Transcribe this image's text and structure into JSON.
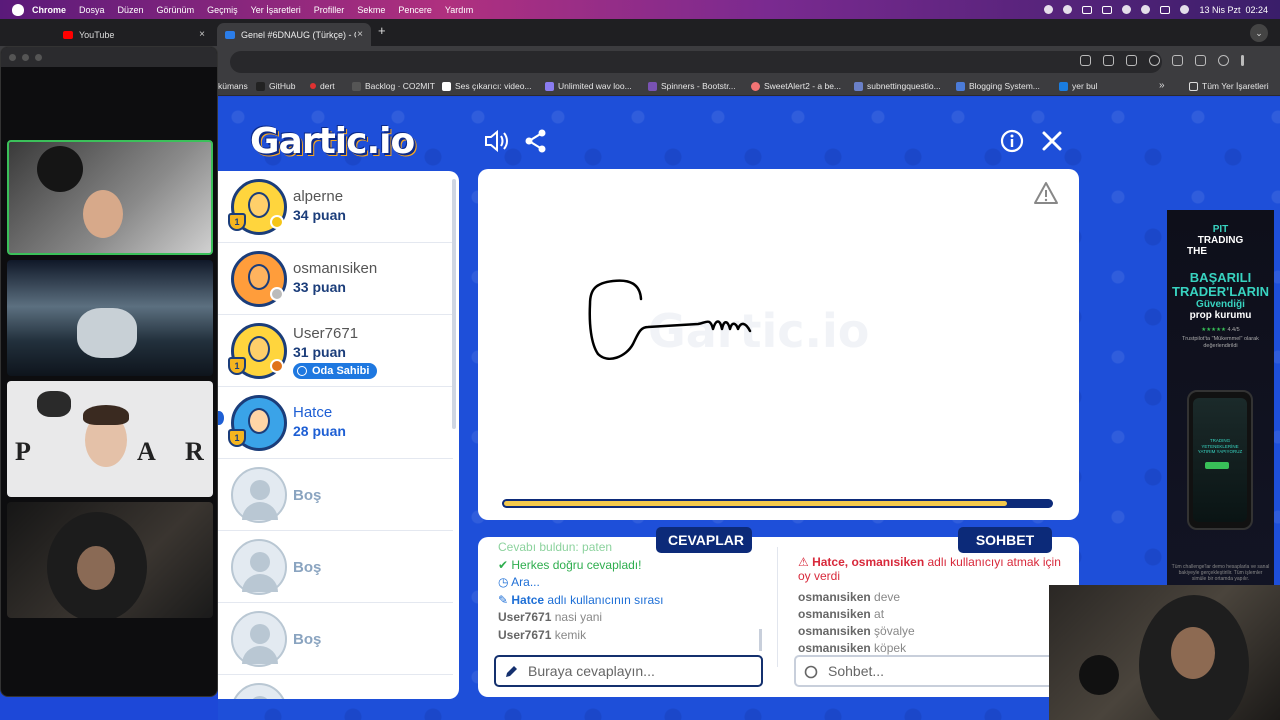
{
  "menubar": {
    "app": "Chrome",
    "items": [
      "Dosya",
      "Düzen",
      "Görünüm",
      "Geçmiş",
      "Yer İşaretleri",
      "Profiller",
      "Sekme",
      "Pencere",
      "Yardım"
    ],
    "clock": "13 Nis Pzt  02:24"
  },
  "tabs": [
    {
      "title": "YouTube",
      "favicon_color": "#ff0000"
    },
    {
      "title": "Genel #6DNAUG (Türkçe) - G",
      "favicon_color": "#2b7de9"
    }
  ],
  "bookmarks": [
    {
      "label": "kümans"
    },
    {
      "label": "GitHub"
    },
    {
      "label": "dert"
    },
    {
      "label": "Backlog · CO2MIT"
    },
    {
      "label": "Ses çıkarıcı: video..."
    },
    {
      "label": "Unlimited wav loo..."
    },
    {
      "label": "Spinners - Bootstr..."
    },
    {
      "label": "SweetAlert2 - a be..."
    },
    {
      "label": "subnettingquestio..."
    },
    {
      "label": "Blogging System..."
    },
    {
      "label": "yer bul"
    },
    {
      "label": "Tüm Yer İşaretleri"
    }
  ],
  "game": {
    "logo": "Gartic.io",
    "watermark": "Gartic.io",
    "timer_fraction": 0.92,
    "players": [
      {
        "name": "alperne",
        "score": "34 puan",
        "avatar": "yellow",
        "status_color": "#f5c518",
        "trophy": true
      },
      {
        "name": "osmanısiken",
        "score": "33 puan",
        "avatar": "orange",
        "status_color": "#bbbbbb",
        "trophy": false
      },
      {
        "name": "User7671",
        "score": "31 puan",
        "avatar": "yellow",
        "status_color": "#e0731a",
        "trophy": true,
        "badge": "Oda Sahibi"
      },
      {
        "name": "Hatce",
        "score": "28 puan",
        "avatar": "blue",
        "trophy": true,
        "active": true
      }
    ],
    "empty_slot_label": "Boş",
    "answers_label": "CEVAPLAR",
    "chat_label": "SOHBET",
    "answers": {
      "partial": "Cevabı buldun: paten",
      "all_correct": "Herkes doğru cevapladı!",
      "interval": "Ara...",
      "turn_name": "Hatce",
      "turn_text": " adlı kullanıcının sırası",
      "guesses": [
        {
          "user": "User7671",
          "text": "nasi yani"
        },
        {
          "user": "User7671",
          "text": "kemik"
        }
      ],
      "placeholder": "Buraya cevaplayın..."
    },
    "chat": {
      "kick_names": "Hatce, osmanısiken",
      "kick_text": " adlı kullanıcıyı atmak için oy verdi",
      "messages": [
        {
          "user": "osmanısiken",
          "text": "deve"
        },
        {
          "user": "osmanısiken",
          "text": "at"
        },
        {
          "user": "osmanısiken",
          "text": "şövalye"
        },
        {
          "user": "osmanısiken",
          "text": "köpek"
        }
      ],
      "placeholder": "Sohbet..."
    }
  },
  "ad": {
    "line1": "PIT",
    "line2": "TRADING",
    "line3": "THE",
    "headline1": "BAŞARILI",
    "headline2": "TRADER'LARIN",
    "sub1": "Güvendiği",
    "sub2": "prop kurumu",
    "rating": "4.4/5",
    "trustpilot": "Trustpilot'ta \"Mükemmel\" olarak değerlendirildi",
    "phone_text": "TRADING YETENEKLERİNE YATIRIM YAPIYORUZ",
    "footer": "Tüm challenge'lar demo hesaplarla ve sanal bakiyeyle gerçekleştirilir. Tüm işlemler simüle bir ortamda yapılır."
  }
}
